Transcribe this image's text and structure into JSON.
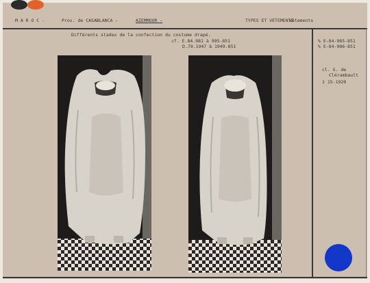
{
  "header": {
    "country": "M A R O C  -",
    "province": "Prov. de CASABLANCA -",
    "place": "AZEMMOUR -",
    "category": "TYPES ET VETEMENTS",
    "subcategory": "Vêtements"
  },
  "caption": {
    "title": "Différents stades de la confection du costume drapé.",
    "ref1": "cf. E.84.981 à 995-851",
    "ref2": "D.79.1947 à 1949.851"
  },
  "side": {
    "inv1": "% E-84-985-851",
    "inv2": "% E-84-986-851",
    "credit1": "cl. G. de",
    "credit2": "Clérambault",
    "date": "1 15-1920"
  },
  "colors": {
    "card": "#cdbfb0",
    "rule": "#3b3633",
    "stamp": "#1136c8",
    "dot_black": "#2b2b2b",
    "dot_orange": "#e0622a"
  },
  "photos": [
    {
      "subject": "draped-costume-stage-1"
    },
    {
      "subject": "draped-costume-stage-2"
    }
  ]
}
